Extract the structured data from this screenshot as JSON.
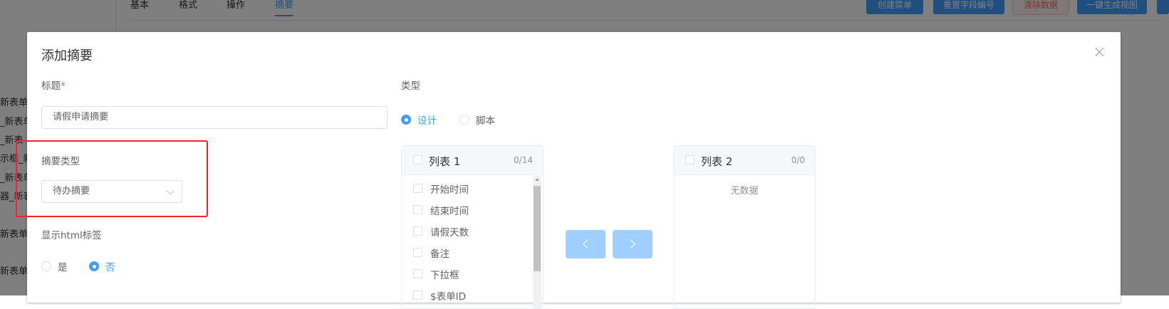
{
  "background": {
    "sidebar_items": [
      "新表单",
      "_新表单",
      "_新表",
      "示框_新",
      "_新表单",
      "器_新表",
      "新表单",
      "新表单"
    ],
    "tabs": [
      "基本",
      "格式",
      "操作",
      "摘要"
    ],
    "buttons": [
      "创建菜单",
      "重置字段编号",
      "清除数据",
      "一键生成视图"
    ]
  },
  "dialog": {
    "title": "添加摘要",
    "title_field": {
      "label": "标题",
      "required_mark": "*",
      "value": "请假申请摘要"
    },
    "type_field": {
      "label": "类型",
      "options": [
        "设计",
        "脚本"
      ],
      "selected": "设计"
    },
    "summary_type": {
      "label": "摘要类型",
      "value": "待办摘要"
    },
    "show_html": {
      "label": "显示html标签",
      "options": [
        "是",
        "否"
      ],
      "selected": "否"
    },
    "transfer": {
      "left": {
        "title": "列表 1",
        "count": "0/14",
        "items": [
          "开始时间",
          "结束时间",
          "请假天数",
          "备注",
          "下拉框",
          "$表单ID"
        ]
      },
      "right": {
        "title": "列表 2",
        "count": "0/0",
        "empty_text": "无数据"
      }
    }
  },
  "colors": {
    "primary": "#409eff",
    "highlight": "#e8282b",
    "overlay": "rgba(0,0,0,0.5)"
  }
}
